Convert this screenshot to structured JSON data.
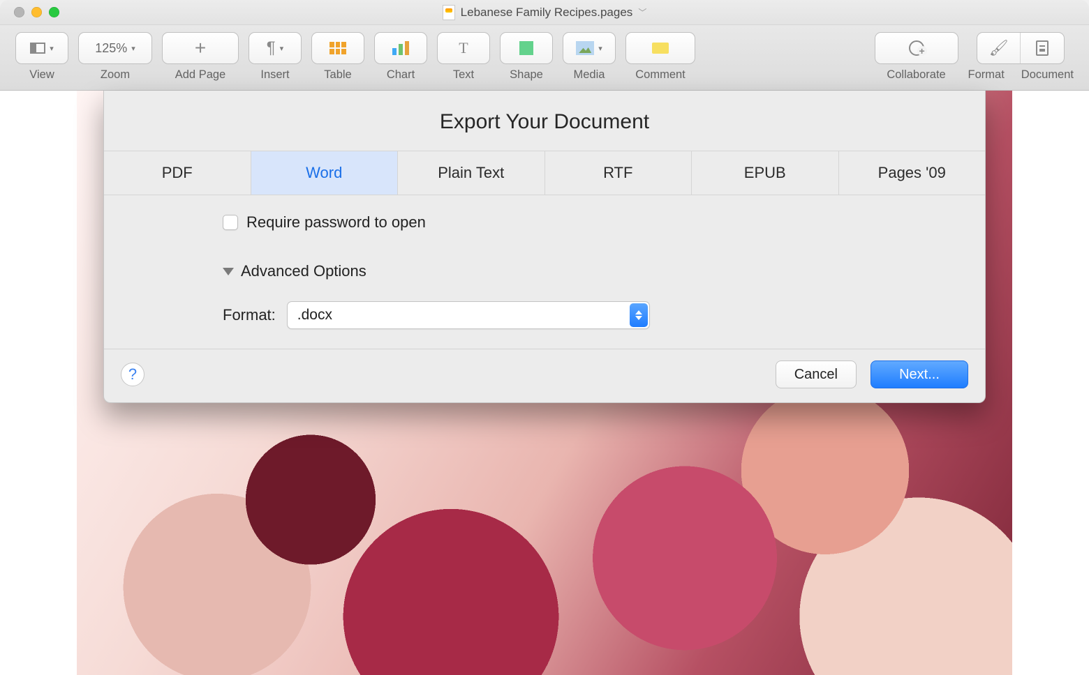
{
  "window": {
    "doc_title": "Lebanese Family Recipes.pages"
  },
  "toolbar": {
    "view": {
      "label": "View"
    },
    "zoom": {
      "label": "Zoom",
      "value": "125%"
    },
    "addpage": {
      "label": "Add Page"
    },
    "insert": {
      "label": "Insert"
    },
    "table": {
      "label": "Table"
    },
    "chart": {
      "label": "Chart"
    },
    "text": {
      "label": "Text"
    },
    "shape": {
      "label": "Shape"
    },
    "media": {
      "label": "Media"
    },
    "comment": {
      "label": "Comment"
    },
    "collab": {
      "label": "Collaborate"
    },
    "format": {
      "label": "Format"
    },
    "document": {
      "label": "Document"
    }
  },
  "export": {
    "title": "Export Your Document",
    "tabs": {
      "pdf": "PDF",
      "word": "Word",
      "plain": "Plain Text",
      "rtf": "RTF",
      "epub": "EPUB",
      "pages09": "Pages '09"
    },
    "active_tab": "word",
    "require_password_label": "Require password to open",
    "require_password_checked": false,
    "advanced_label": "Advanced Options",
    "advanced_expanded": true,
    "format_label": "Format:",
    "format_value": ".docx",
    "cancel": "Cancel",
    "next": "Next...",
    "help_glyph": "?"
  }
}
